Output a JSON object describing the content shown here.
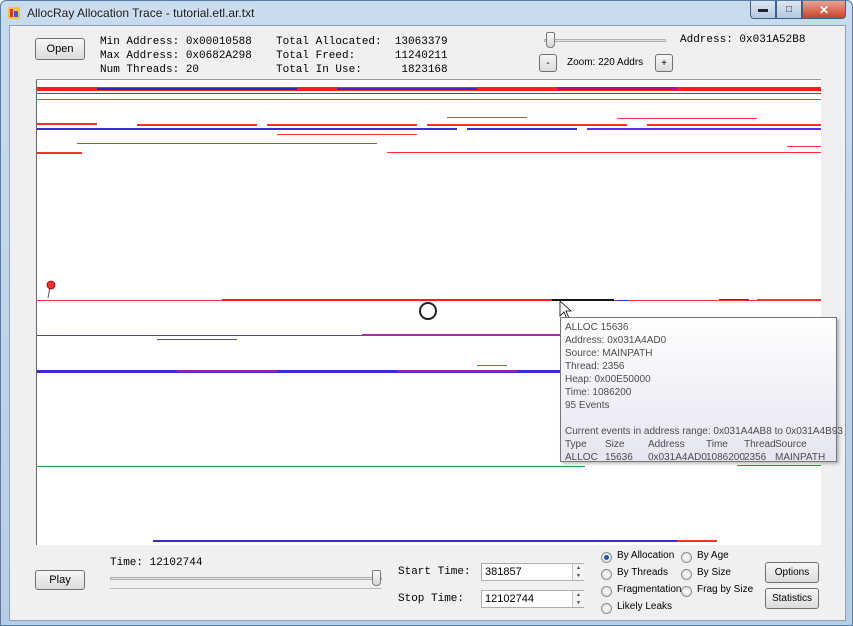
{
  "window": {
    "title": "AllocRay Allocation Trace - tutorial.etl.ar.txt",
    "controls": {
      "minimize": "▬",
      "maximize": "□",
      "close": "✕"
    }
  },
  "toolbar": {
    "open_label": "Open",
    "stats": {
      "min_address": "Min Address: 0x00010588",
      "max_address": "Max Address: 0x0682A298",
      "num_threads": "Num Threads: 20",
      "total_allocated": "Total Allocated:  13063379",
      "total_freed": "Total Freed:      11240211",
      "total_in_use": "Total In Use:      1823168"
    },
    "address": "Address: 0x031A52B8",
    "zoom_minus": "-",
    "zoom_label": "Zoom: 220 Addrs",
    "zoom_plus": "+"
  },
  "tooltip": {
    "lines": [
      "ALLOC 15636",
      "Address: 0x031A4AD0",
      "Source: MAINPATH",
      "Thread: 2356",
      "Heap: 0x00E50000",
      "Time: 1086200",
      "95 Events",
      "",
      "Current events in address range: 0x031A4AB8 to 0x031A4B93"
    ],
    "table_headers": [
      "Type",
      "Size",
      "Address",
      "Time",
      "Thread",
      "Source"
    ],
    "table_row": [
      "ALLOC",
      "15636",
      "0x031A4AD0",
      "1086200",
      "2356",
      "MAINPATH"
    ]
  },
  "playback": {
    "play_label": "Play",
    "time_label": "Time: 12102744",
    "time_fraction": 1.0,
    "start_time_label": "Start Time:",
    "start_time_value": "381857",
    "stop_time_label": "Stop Time:",
    "stop_time_value": "12102744"
  },
  "view_modes": {
    "options": [
      "By Allocation",
      "By Age",
      "By Threads",
      "By Size",
      "Fragmentation",
      "Frag by Size",
      "Likely Leaks"
    ],
    "selected": "By Allocation"
  },
  "buttons": {
    "options": "Options",
    "statistics": "Statistics"
  },
  "colors": {
    "alloc_red": "#ff2020",
    "alloc_blue": "#3a2bd8",
    "alloc_green": "#2a9a2a",
    "alloc_magenta": "#c020a0",
    "selected_black": "#111111"
  }
}
